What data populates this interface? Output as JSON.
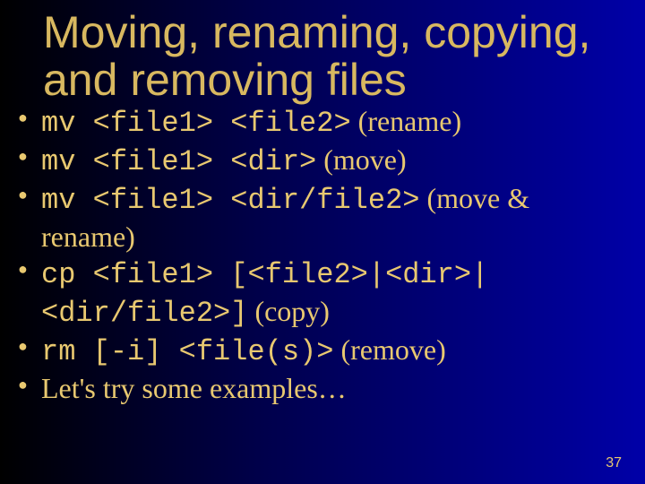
{
  "title": "Moving, renaming, copying, and removing files",
  "bullets": [
    {
      "code": "mv <file1> <file2>",
      "note": " (rename)"
    },
    {
      "code": "mv <file1> <dir>",
      "note": " (move)"
    },
    {
      "code": "mv <file1> <dir/file2>",
      "note": " (move & rename)"
    },
    {
      "code": "cp <file1> [<file2>|<dir>|<dir/file2>]",
      "note": " (copy)"
    },
    {
      "code": "rm [-i] <file(s)>",
      "note": " (remove)"
    },
    {
      "code": "",
      "note": "Let's try some examples…"
    }
  ],
  "page_number": "37"
}
